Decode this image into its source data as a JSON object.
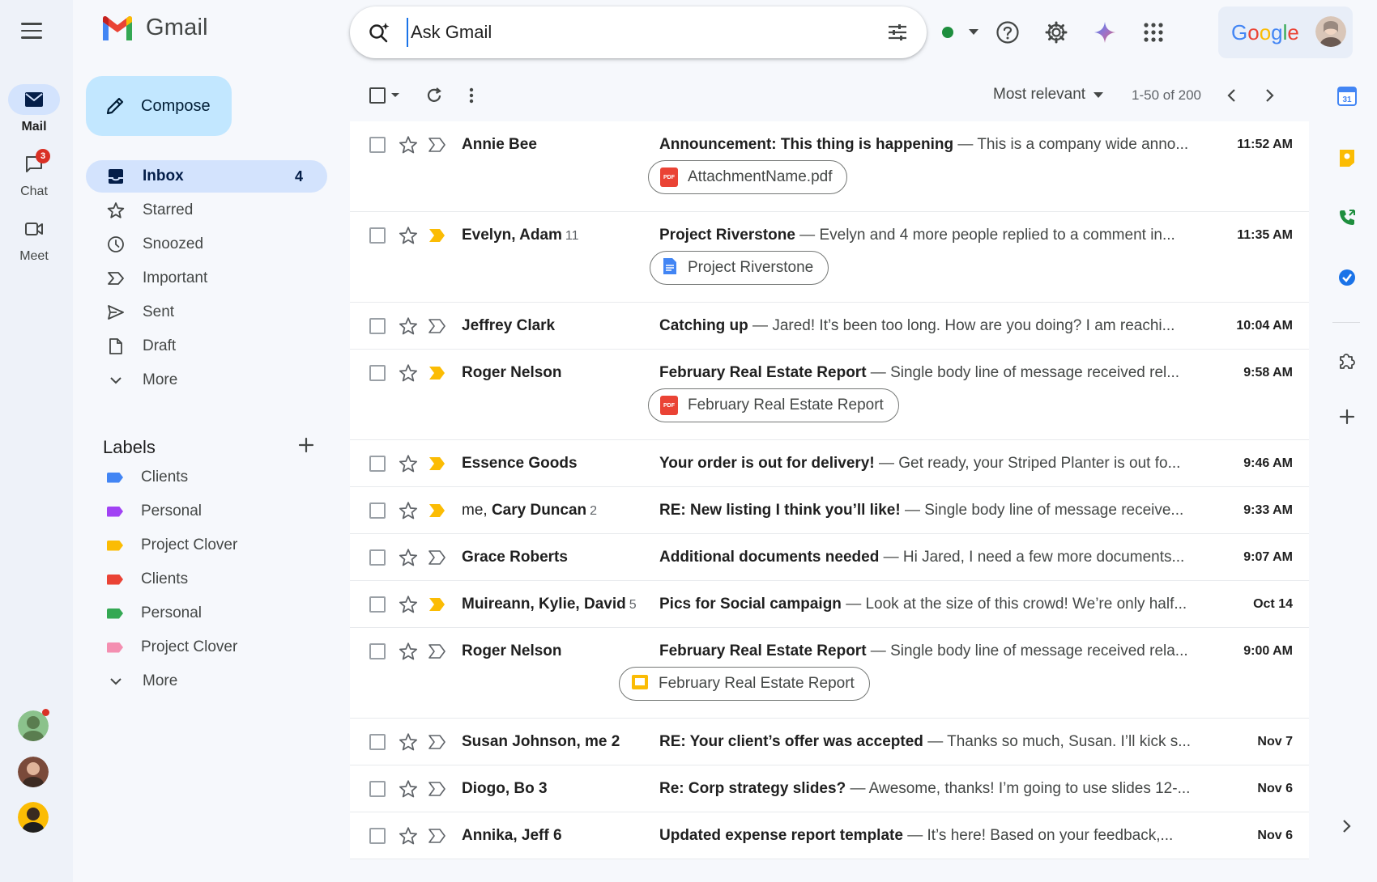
{
  "app": {
    "name": "Gmail"
  },
  "rail": {
    "items": [
      {
        "label": "Mail",
        "icon": "mail-icon",
        "active": true
      },
      {
        "label": "Chat",
        "icon": "chat-icon",
        "badge": "3"
      },
      {
        "label": "Meet",
        "icon": "video-icon"
      }
    ]
  },
  "search": {
    "placeholder": "Ask Gmail"
  },
  "account": {
    "brand_word": "Google"
  },
  "compose": {
    "label": "Compose"
  },
  "nav": [
    {
      "label": "Inbox",
      "count": "4",
      "icon": "inbox-icon",
      "active": true
    },
    {
      "label": "Starred",
      "icon": "star-icon"
    },
    {
      "label": "Snoozed",
      "icon": "clock-icon"
    },
    {
      "label": "Important",
      "icon": "important-icon"
    },
    {
      "label": "Sent",
      "icon": "send-icon"
    },
    {
      "label": "Draft",
      "icon": "draft-icon"
    },
    {
      "label": "More",
      "icon": "chevron-down-icon"
    }
  ],
  "labels": {
    "title": "Labels",
    "items": [
      {
        "label": "Clients",
        "color": "#4285f4"
      },
      {
        "label": "Personal",
        "color": "#a142f4"
      },
      {
        "label": "Project Clover",
        "color": "#fbbc04"
      },
      {
        "label": "Clients",
        "color": "#ea4335"
      },
      {
        "label": "Personal",
        "color": "#34a853"
      },
      {
        "label": "Project Clover",
        "color": "#f48fb1"
      }
    ],
    "more": "More"
  },
  "toolbar": {
    "sort_label": "Most relevant",
    "page_info": "1-50 of 200"
  },
  "emails": [
    {
      "sender": "Annie Bee",
      "subject": "Announcement: This thing is happening",
      "snippet": " — This is a company wide anno...",
      "time": "11:52 AM",
      "important": false,
      "attachment": {
        "name": "AttachmentName.pdf",
        "type": "pdf"
      }
    },
    {
      "sender": "Evelyn, Adam",
      "count": "11",
      "subject": "Project Riverstone",
      "snippet": " — Evelyn and 4 more people replied to a comment in...",
      "time": "11:35 AM",
      "important": true,
      "attachment": {
        "name": "Project Riverstone",
        "type": "doc"
      }
    },
    {
      "sender": "Jeffrey Clark",
      "subject": "Catching up",
      "snippet": " — Jared! It’s been too long. How are you doing? I am reachi...",
      "time": "10:04 AM",
      "important": false
    },
    {
      "sender": "Roger Nelson",
      "subject": "February Real Estate Report",
      "snippet": " — Single body line of message received rel...",
      "time": "9:58 AM",
      "important": true,
      "attachment": {
        "name": "February Real Estate Report",
        "type": "pdf"
      }
    },
    {
      "sender": "Essence Goods",
      "subject": "Your order is out for delivery!",
      "snippet": " — Get ready, your Striped Planter is out fo...",
      "time": "9:46 AM",
      "important": true
    },
    {
      "sender_prefix": "me, ",
      "sender": "Cary Duncan",
      "count": "2",
      "subject": "RE: New listing I think you’ll like!",
      "snippet": " — Single body line of message receive...",
      "time": "9:33 AM",
      "important": true
    },
    {
      "sender": "Grace Roberts",
      "subject": "Additional documents needed",
      "snippet": " — Hi Jared, I need a few more documents...",
      "time": "9:07 AM",
      "important": false
    },
    {
      "sender": "Muireann, Kylie, David",
      "count": "5",
      "subject": "Pics for Social campaign",
      "snippet": " — Look at the size of this crowd! We’re only half...",
      "time": "Oct 14",
      "important": true
    },
    {
      "sender": "Roger Nelson",
      "subject": "February Real Estate Report",
      "snippet": " — Single body line of message received rela...",
      "time": "9:00 AM",
      "important": false,
      "attachment": {
        "name": "February Real Estate Report",
        "type": "slides"
      }
    },
    {
      "sender": "Susan Johnson, me 2",
      "subject": "RE: Your client’s offer was accepted",
      "snippet": " — Thanks so much, Susan. I’ll kick s...",
      "time": "Nov 7",
      "important": false
    },
    {
      "sender": "Diogo, Bo 3",
      "subject": "Re: Corp strategy slides?",
      "snippet": " — Awesome, thanks! I’m going to use slides 12-...",
      "time": "Nov 6",
      "important": false
    },
    {
      "sender": "Annika, Jeff 6",
      "subject": "Updated expense report template",
      "snippet": " — It’s here! Based on your feedback,...",
      "time": "Nov 6",
      "important": false
    }
  ],
  "colors": {
    "accent": "#1a73e8",
    "compose_bg": "#c2e7ff",
    "active_nav": "#d3e3fd",
    "important": "#fbbc04"
  }
}
